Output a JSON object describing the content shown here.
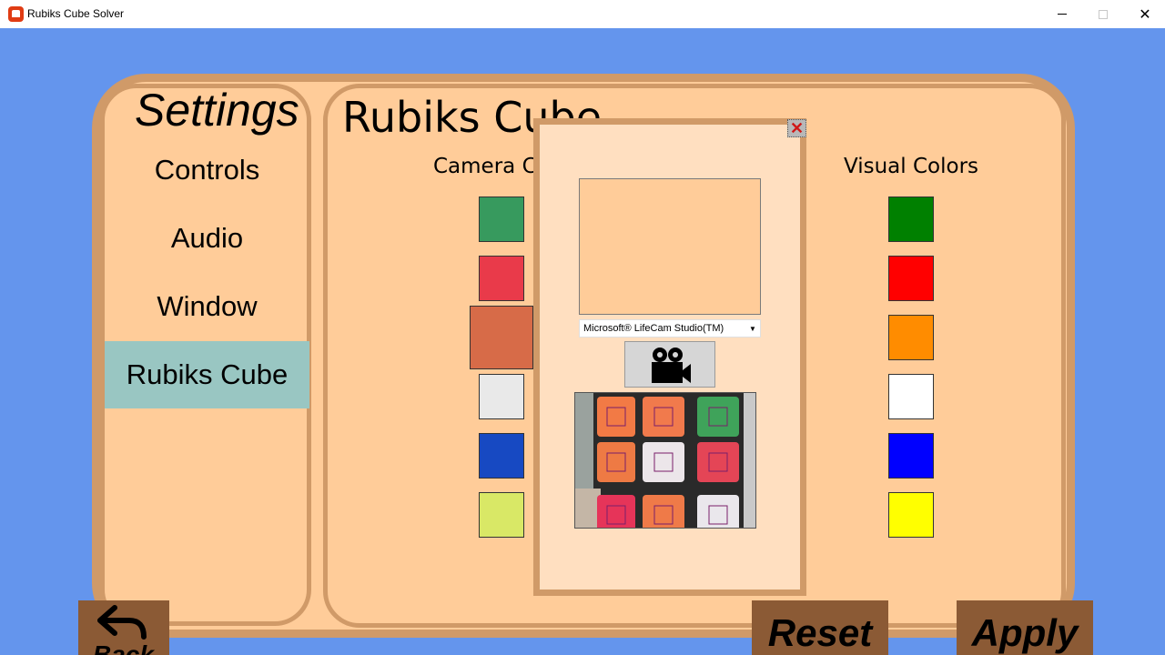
{
  "window": {
    "title": "Rubiks Cube Solver",
    "minimize_glyph": "",
    "close_glyph": "✕"
  },
  "sidebar": {
    "title": "Settings",
    "items": [
      {
        "label": "Controls"
      },
      {
        "label": "Audio"
      },
      {
        "label": "Window"
      },
      {
        "label": "Rubiks Cube",
        "selected": true
      }
    ]
  },
  "content": {
    "title": "Rubiks Cube",
    "camera_colors_label": "Camera Co",
    "visual_colors_label": "Visual Colors",
    "camera_colors": [
      "#379A5E",
      "#E93A4A",
      "#D76B48",
      "#E9E9E9",
      "#1749C2",
      "#D9E866"
    ],
    "visual_colors": [
      "#008000",
      "#FF0000",
      "#FF8C00",
      "#FFFFFF",
      "#0000FF",
      "#FFFF00"
    ]
  },
  "popup": {
    "close_glyph": "✕",
    "camera_device": "Microsoft® LifeCam Studio(TM)",
    "capture_icon": "video-camera-icon",
    "cube_face_colors": [
      "#F27A45",
      "#F17A4C",
      "#3FA35A",
      "#EE7A44",
      "#ECE6EA",
      "#E44556",
      "#E63459",
      "#EF7A48",
      "#EAE7EC"
    ]
  },
  "buttons": {
    "back": "Back",
    "reset": "Reset",
    "apply": "Apply"
  }
}
